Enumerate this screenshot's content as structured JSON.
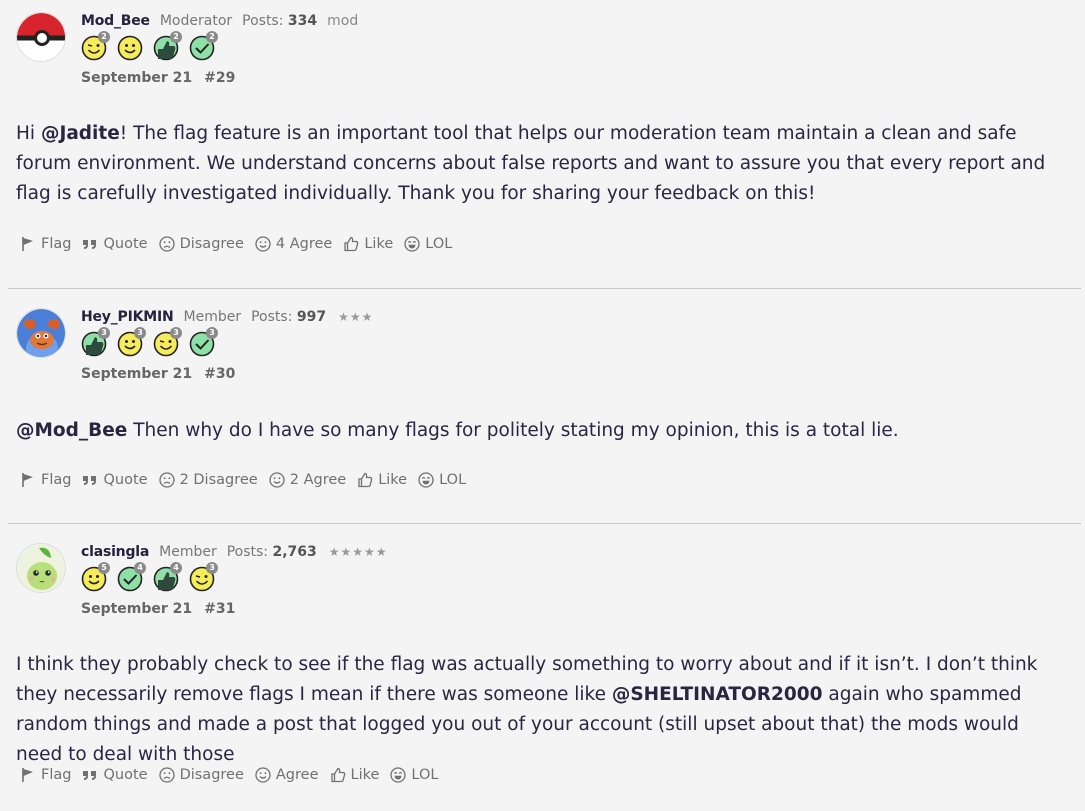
{
  "posts": [
    {
      "username": "Mod_Bee",
      "role": "Moderator",
      "posts_label": "Posts:",
      "posts_count": "334",
      "extra": "mod",
      "stars": "",
      "date": "September 21",
      "number": "#29",
      "badges": [
        {
          "icon": "wink-face-icon",
          "count": "2"
        },
        {
          "icon": "smile-face-icon",
          "count": ""
        },
        {
          "icon": "thumbs-up-icon",
          "count": "2"
        },
        {
          "icon": "check-icon",
          "count": "2"
        }
      ],
      "body": {
        "pre": "Hi ",
        "mention": "@Jadite",
        "post": "! The flag feature is an important tool that helps our moderation team maintain a clean and safe forum environment. We understand concerns about false reports and want to assure you that every report and flag is carefully investigated individually. Thank you for sharing your feedback on this!"
      },
      "actions": {
        "flag": "Flag",
        "quote": "Quote",
        "disagree": "Disagree",
        "agree": "4 Agree",
        "like": "Like",
        "lol": "LOL"
      }
    },
    {
      "username": "Hey_PIKMIN",
      "role": "Member",
      "posts_label": "Posts:",
      "posts_count": "997",
      "extra": "",
      "stars": "★★★",
      "date": "September 21",
      "number": "#30",
      "badges": [
        {
          "icon": "thumbs-up-icon",
          "count": "3"
        },
        {
          "icon": "smile-face-icon",
          "count": "3"
        },
        {
          "icon": "wink-face-icon",
          "count": "3"
        },
        {
          "icon": "check-icon",
          "count": "3"
        }
      ],
      "body": {
        "pre": "",
        "mention": "@Mod_Bee",
        "post": " Then why do I have so many flags for politely stating my opinion, this is a total lie."
      },
      "actions": {
        "flag": "Flag",
        "quote": "Quote",
        "disagree": "2 Disagree",
        "agree": "2 Agree",
        "like": "Like",
        "lol": "LOL"
      }
    },
    {
      "username": "clasingla",
      "role": "Member",
      "posts_label": "Posts:",
      "posts_count": "2,763",
      "extra": "",
      "stars": "★★★★★",
      "date": "September 21",
      "number": "#31",
      "badges": [
        {
          "icon": "smile-face-icon",
          "count": "5"
        },
        {
          "icon": "check-icon",
          "count": "4"
        },
        {
          "icon": "thumbs-up-icon",
          "count": "4"
        },
        {
          "icon": "wink-face-icon",
          "count": "3"
        }
      ],
      "body": {
        "pre": "I think they probably check to see if the flag was actually something to worry about and if it isn’t. I don’t think they necessarily remove flags I mean if there was someone like ",
        "mention": "@SHELTINATOR2000",
        "post": " again who spammed random things and made a post that logged you out of your account (still upset about that) the mods would need to deal with those"
      },
      "actions": {
        "flag": "Flag",
        "quote": "Quote",
        "disagree": "Disagree",
        "agree": "Agree",
        "like": "Like",
        "lol": "LOL"
      }
    }
  ],
  "colors": {
    "background": "#f4f4f4",
    "text": "#2a2540",
    "muted": "#707070",
    "badge_yellow": "#f6ec5a",
    "badge_green": "#8fe0a8",
    "badge_dark": "#2d4a3c"
  }
}
